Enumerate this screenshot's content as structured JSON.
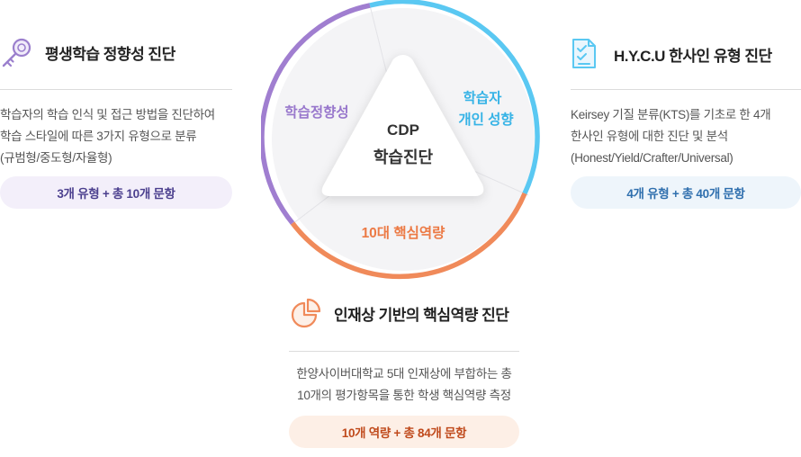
{
  "left_panel": {
    "icon": "key-icon",
    "title": "평생학습 정향성 진단",
    "description": "학습자의 학습 인식 및 접근 방법을 진단하여\n학습 스타일에 따른 3가지 유형으로 분류\n(규범형/중도형/자율형)",
    "badge": "3개 유형 + 총 10개 문항"
  },
  "right_panel": {
    "icon": "checklist-icon",
    "title": "H.Y.C.U 한사인 유형 진단",
    "description": "Keirsey 기질 분류(KTS)를 기초로 한 4개\n한사인 유형에 대한 진단 및 분석\n(Honest/Yield/Crafter/Universal)",
    "badge": "4개 유형 + 총 40개 문항"
  },
  "bottom_panel": {
    "icon": "pie-chart-icon",
    "title": "인재상 기반의 핵심역량 진단",
    "description": "한양사이버대학교 5대 인재상에 부합하는 총\n10개의 평가항목을 통한 학생 핵심역량 측정",
    "badge": "10개 역량 + 총 84개 문항"
  },
  "center": {
    "line1": "CDP",
    "line2": "학습진단",
    "segments": {
      "left": "학습정향성",
      "right_line1": "학습자",
      "right_line2": "개인 성향",
      "bottom": "10대 핵심역량"
    }
  },
  "colors": {
    "purple": "#a07ed0",
    "blue": "#5ac8f2",
    "orange": "#f08a5a",
    "pill_purple_bg": "#f3effa",
    "pill_blue_bg": "#eef5fb",
    "pill_orange_bg": "#fdefe6"
  }
}
